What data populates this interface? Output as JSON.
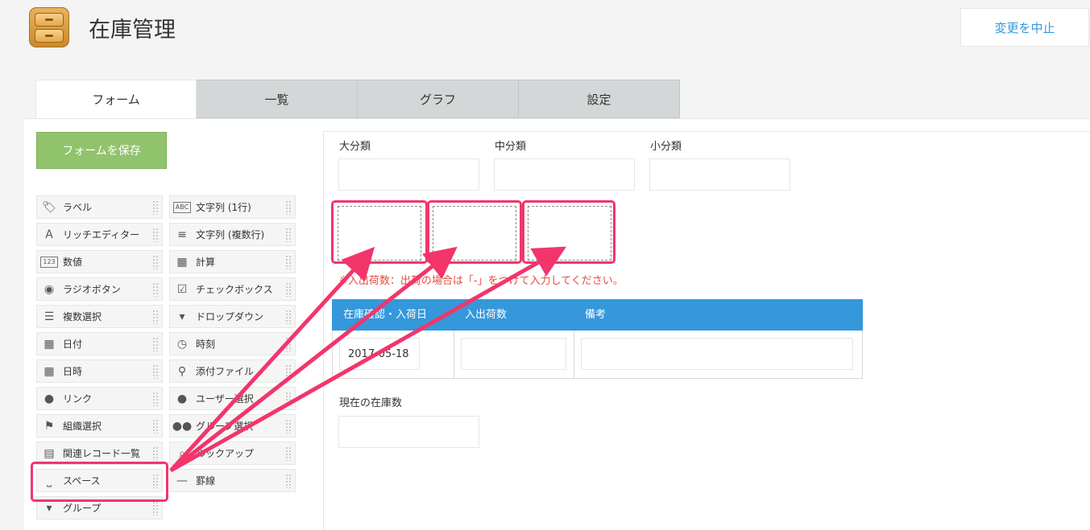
{
  "app": {
    "title": "在庫管理",
    "cancel_label": "変更を中止"
  },
  "tabs": [
    {
      "label": "フォーム",
      "active": true
    },
    {
      "label": "一覧",
      "active": false
    },
    {
      "label": "グラフ",
      "active": false
    },
    {
      "label": "設定",
      "active": false
    }
  ],
  "save_label": "フォームを保存",
  "palette": {
    "left": [
      {
        "label": "ラベル",
        "icon": "tag-icon"
      },
      {
        "label": "リッチエディター",
        "icon": "rich-editor-icon"
      },
      {
        "label": "数値",
        "icon": "number-icon"
      },
      {
        "label": "ラジオボタン",
        "icon": "radio-icon"
      },
      {
        "label": "複数選択",
        "icon": "multi-select-icon"
      },
      {
        "label": "日付",
        "icon": "calendar-icon"
      },
      {
        "label": "日時",
        "icon": "datetime-icon"
      },
      {
        "label": "リンク",
        "icon": "globe-icon"
      },
      {
        "label": "組織選択",
        "icon": "org-icon"
      },
      {
        "label": "関連レコード一覧",
        "icon": "related-records-icon"
      },
      {
        "label": "スペース",
        "icon": "space-icon"
      },
      {
        "label": "グループ",
        "icon": "group-icon"
      }
    ],
    "right": [
      {
        "label": "文字列 (1行)",
        "icon": "abc-icon"
      },
      {
        "label": "文字列 (複数行)",
        "icon": "multiline-icon"
      },
      {
        "label": "計算",
        "icon": "calculator-icon"
      },
      {
        "label": "チェックボックス",
        "icon": "checkbox-icon"
      },
      {
        "label": "ドロップダウン",
        "icon": "dropdown-icon"
      },
      {
        "label": "時刻",
        "icon": "clock-icon"
      },
      {
        "label": "添付ファイル",
        "icon": "paperclip-icon"
      },
      {
        "label": "ユーザー選択",
        "icon": "user-icon"
      },
      {
        "label": "グループ選択",
        "icon": "users-icon"
      },
      {
        "label": "ルックアップ",
        "icon": "lookup-icon"
      },
      {
        "label": "罫線",
        "icon": "line-icon"
      }
    ]
  },
  "form": {
    "fields": [
      {
        "label": "大分類",
        "value": ""
      },
      {
        "label": "中分類",
        "value": ""
      },
      {
        "label": "小分類",
        "value": ""
      }
    ],
    "note": "※入出荷数：出荷の場合は「-」をつけて入力してください。",
    "table": {
      "headers": [
        "在庫確認・入荷日",
        "入出荷数",
        "備考"
      ],
      "row": [
        "2017-05-18",
        "",
        ""
      ]
    },
    "stock_label": "現在の在庫数",
    "stock_value": ""
  },
  "colors": {
    "accent": "#3498db",
    "save": "#91c36c",
    "note": "#e74c3c",
    "highlight": "#f2356b"
  }
}
